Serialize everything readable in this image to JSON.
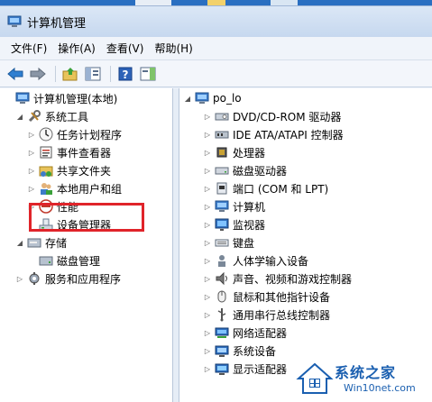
{
  "window": {
    "title": "计算机管理"
  },
  "menu": [
    "文件(F)",
    "操作(A)",
    "查看(V)",
    "帮助(H)"
  ],
  "left_tree": [
    {
      "label": "计算机管理(本地)",
      "icon": "computer-manage-icon",
      "exp": "",
      "indent": 0
    },
    {
      "label": "系统工具",
      "icon": "tools-icon",
      "exp": "open",
      "indent": 1
    },
    {
      "label": "任务计划程序",
      "icon": "clock-icon",
      "exp": "closed",
      "indent": 2
    },
    {
      "label": "事件查看器",
      "icon": "event-viewer-icon",
      "exp": "closed",
      "indent": 2
    },
    {
      "label": "共享文件夹",
      "icon": "shared-folder-icon",
      "exp": "closed",
      "indent": 2
    },
    {
      "label": "本地用户和组",
      "icon": "users-icon",
      "exp": "closed",
      "indent": 2
    },
    {
      "label": "性能",
      "icon": "performance-icon",
      "exp": "closed",
      "indent": 2
    },
    {
      "label": "设备管理器",
      "icon": "device-manager-icon",
      "exp": "",
      "indent": 2
    },
    {
      "label": "存储",
      "icon": "storage-icon",
      "exp": "open",
      "indent": 1
    },
    {
      "label": "磁盘管理",
      "icon": "disk-manage-icon",
      "exp": "",
      "indent": 2
    },
    {
      "label": "服务和应用程序",
      "icon": "services-icon",
      "exp": "closed",
      "indent": 1
    }
  ],
  "right_tree": {
    "root": "po_lo",
    "items": [
      {
        "label": "DVD/CD-ROM 驱动器",
        "icon": "dvd-drive-icon"
      },
      {
        "label": "IDE ATA/ATAPI 控制器",
        "icon": "ide-controller-icon"
      },
      {
        "label": "处理器",
        "icon": "processor-icon"
      },
      {
        "label": "磁盘驱动器",
        "icon": "disk-drive-icon"
      },
      {
        "label": "端口 (COM 和 LPT)",
        "icon": "port-icon"
      },
      {
        "label": "计算机",
        "icon": "computer-icon"
      },
      {
        "label": "监视器",
        "icon": "monitor-icon"
      },
      {
        "label": "键盘",
        "icon": "keyboard-icon"
      },
      {
        "label": "人体学输入设备",
        "icon": "hid-icon"
      },
      {
        "label": "声音、视频和游戏控制器",
        "icon": "sound-icon"
      },
      {
        "label": "鼠标和其他指针设备",
        "icon": "mouse-icon"
      },
      {
        "label": "通用串行总线控制器",
        "icon": "usb-icon"
      },
      {
        "label": "网络适配器",
        "icon": "network-adapter-icon"
      },
      {
        "label": "系统设备",
        "icon": "system-device-icon"
      },
      {
        "label": "显示适配器",
        "icon": "display-adapter-icon"
      }
    ]
  },
  "watermark": {
    "title": "系统之家",
    "url": "Win10net.com"
  },
  "colors": {
    "highlight": "#e0242a",
    "watermark": "#1a5fb0"
  }
}
